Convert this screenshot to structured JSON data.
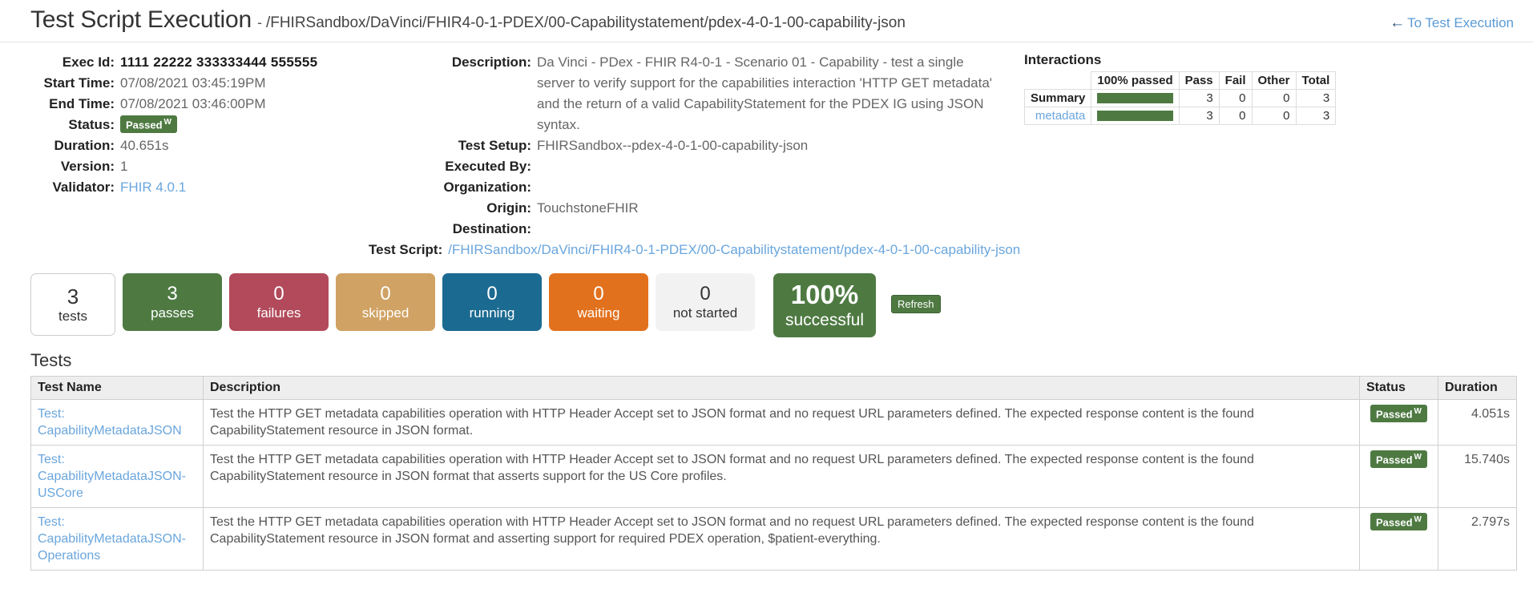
{
  "header": {
    "title": "Test Script Execution",
    "separator": "-",
    "path": "/FHIRSandbox/DaVinci/FHIR4-0-1-PDEX/00-Capabilitystatement/pdex-4-0-1-00-capability-json",
    "back_link": "To Test Execution",
    "back_arrow": "←"
  },
  "details_left": [
    {
      "label": "Exec Id:",
      "value": "1111 22222 333333444 555555",
      "style": "black"
    },
    {
      "label": "Start Time:",
      "value": "07/08/2021 03:45:19PM",
      "style": "plain"
    },
    {
      "label": "End Time:",
      "value": "07/08/2021 03:46:00PM",
      "style": "plain"
    },
    {
      "label": "Status:",
      "value": "Passed",
      "style": "badge",
      "badge_sup": "W"
    },
    {
      "label": "Duration:",
      "value": "40.651s",
      "style": "plain"
    },
    {
      "label": "Version:",
      "value": "1",
      "style": "plain"
    },
    {
      "label": "Validator:",
      "value": "FHIR 4.0.1",
      "style": "link"
    }
  ],
  "details_mid": [
    {
      "label": "Description:",
      "value": "Da Vinci - PDex - FHIR R4-0-1 - Scenario 01 - Capability - test a single server to verify support for the capabilities interaction 'HTTP GET metadata' and the return of a valid CapabilityStatement for the PDEX IG using JSON syntax.",
      "style": "wrap"
    },
    {
      "label": "Test Setup:",
      "value": "FHIRSandbox--pdex-4-0-1-00-capability-json",
      "style": "plain"
    },
    {
      "label": "Executed By:",
      "value": "",
      "style": "plain"
    },
    {
      "label": "Organization:",
      "value": "",
      "style": "plain"
    },
    {
      "label": "Origin:",
      "value": "TouchstoneFHIR",
      "style": "plain"
    },
    {
      "label": "Destination:",
      "value": "",
      "style": "plain"
    },
    {
      "label": "Test Script:",
      "value": "/FHIRSandbox/DaVinci/FHIR4-0-1-PDEX/00-Capabilitystatement/pdex-4-0-1-00-capability-json",
      "style": "link"
    }
  ],
  "interactions": {
    "title": "Interactions",
    "columns": [
      "",
      "100% passed",
      "Pass",
      "Fail",
      "Other",
      "Total"
    ],
    "rows": [
      {
        "name": "Summary",
        "is_link": false,
        "meter_pct": 100,
        "pass": "3",
        "fail": "0",
        "other": "0",
        "total": "3"
      },
      {
        "name": "metadata",
        "is_link": true,
        "meter_pct": 100,
        "pass": "3",
        "fail": "0",
        "other": "0",
        "total": "3"
      }
    ]
  },
  "stats": [
    {
      "num": "3",
      "label": "tests",
      "kind": "tests",
      "color": "#ffffff"
    },
    {
      "num": "3",
      "label": "passes",
      "kind": "passes",
      "color": "#4e7a42"
    },
    {
      "num": "0",
      "label": "failures",
      "kind": "failures",
      "color": "#b24a5b"
    },
    {
      "num": "0",
      "label": "skipped",
      "kind": "skipped",
      "color": "#d0a263"
    },
    {
      "num": "0",
      "label": "running",
      "kind": "running",
      "color": "#1b6a91"
    },
    {
      "num": "0",
      "label": "waiting",
      "kind": "waiting",
      "color": "#e2711d"
    },
    {
      "num": "0",
      "label": "not started",
      "kind": "notstarted",
      "color": "#f2f2f2"
    }
  ],
  "percent_box": {
    "num": "100%",
    "label": "successful",
    "color": "#4e7a42"
  },
  "refresh_label": "Refresh",
  "tests_section": {
    "heading": "Tests",
    "columns": [
      "Test Name",
      "Description",
      "Status",
      "Duration"
    ],
    "rows": [
      {
        "name_prefix": "Test:",
        "name": "CapabilityMetadataJSON",
        "description": "Test the HTTP GET metadata capabilities operation with HTTP Header Accept set to JSON format and no request URL parameters defined. The expected response content is the found CapabilityStatement resource in JSON format.",
        "status": "Passed",
        "status_sup": "W",
        "duration": "4.051s"
      },
      {
        "name_prefix": "Test:",
        "name": "CapabilityMetadataJSON-USCore",
        "description": "Test the HTTP GET metadata capabilities operation with HTTP Header Accept set to JSON format and no request URL parameters defined. The expected response content is the found CapabilityStatement resource in JSON format that asserts support for the US Core profiles.",
        "status": "Passed",
        "status_sup": "W",
        "duration": "15.740s"
      },
      {
        "name_prefix": "Test:",
        "name": "CapabilityMetadataJSON-Operations",
        "description": "Test the HTTP GET metadata capabilities operation with HTTP Header Accept set to JSON format and no request URL parameters defined. The expected response content is the found CapabilityStatement resource in JSON format and asserting support for required PDEX operation, $patient-everything.",
        "status": "Passed",
        "status_sup": "W",
        "duration": "2.797s"
      }
    ]
  }
}
